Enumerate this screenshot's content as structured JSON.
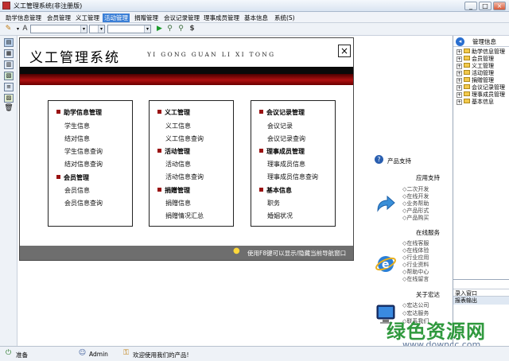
{
  "window": {
    "title": "义工管理系统(非注册版)",
    "min": "_",
    "max": "□",
    "close": "×"
  },
  "menu": [
    "助学信息管理",
    "会员管理",
    "义工管理",
    "活动管理",
    "捐赠管理",
    "会议记录管理",
    "理事成员管理",
    "基本信息",
    "系统(S)"
  ],
  "menu_active": "活动管理",
  "nav": {
    "title": "义工管理系统",
    "pinyin": "YI GONG GUAN LI XI TONG",
    "close": "×",
    "columns": [
      [
        {
          "section": "助学信息管理",
          "links": [
            "学生信息",
            "结对信息",
            "学生信息查询",
            "结对信息查询"
          ]
        },
        {
          "section": "会员管理",
          "links": [
            "会员信息",
            "会员信息查询"
          ]
        }
      ],
      [
        {
          "section": "义工管理",
          "links": [
            "义工信息",
            "义工信息查询"
          ]
        },
        {
          "section": "活动管理",
          "links": [
            "活动信息",
            "活动信息查询"
          ]
        },
        {
          "section": "捐赠管理",
          "links": [
            "捐赠信息",
            "捐赠情况汇总"
          ]
        }
      ],
      [
        {
          "section": "会议记录管理",
          "links": [
            "会议记录",
            "会议记录查询"
          ]
        },
        {
          "section": "理事成员管理",
          "links": [
            "理事成员信息",
            "理事成员信息查询"
          ]
        },
        {
          "section": "基本信息",
          "links": [
            "职务",
            "婚姻状况"
          ]
        }
      ]
    ],
    "footer": "使用F8键可以显示/隐藏当前导航窗口"
  },
  "support": {
    "title": "产品支持",
    "groups": [
      {
        "head": "应用支持",
        "links": [
          "二次开发",
          "在线开发",
          "业务帮助",
          "产品形式",
          "产品购买"
        ]
      },
      {
        "head": "在线服务",
        "links": [
          "在线客服",
          "在线体验",
          "行业应用",
          "行业资料",
          "帮助中心",
          "在线留言"
        ]
      },
      {
        "head": "关于宏达",
        "links": [
          "宏达公司",
          "宏达服务",
          "联系我们"
        ]
      }
    ]
  },
  "right_panel": {
    "title": "管理信息",
    "tree": [
      "助学信息管理",
      "会员管理",
      "义工管理",
      "活动管理",
      "捐赠管理",
      "会议记录管理",
      "理事成员管理",
      "基本信息"
    ],
    "buttons": [
      "录入窗口",
      "报表输出"
    ]
  },
  "status": {
    "ready": "准备",
    "user": "Admin",
    "welcome": "欢迎使用我们的产品!"
  },
  "watermark": {
    "main": "绿色资源网",
    "sub": "www.downcc.com"
  },
  "colors": {
    "accent": "#3b7fd6",
    "band_red": "#b01010",
    "section_marker": "#9a1212",
    "watermark_green": "#1a8f2a"
  }
}
